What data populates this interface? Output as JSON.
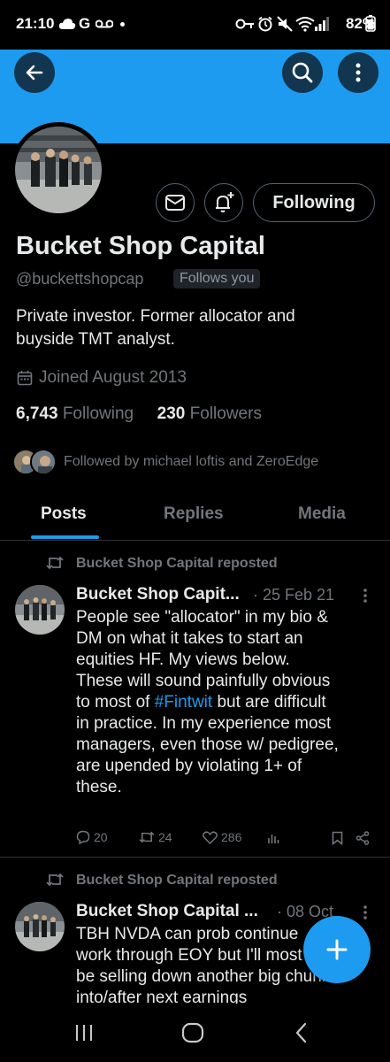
{
  "status_bar": {
    "time": "21:10",
    "carrier_letter": "G",
    "battery": "82%"
  },
  "profile": {
    "display_name": "Bucket Shop Capital",
    "handle": "@buckettshopcap",
    "follows_you_badge": "Follows you",
    "bio_line1": "Private investor. Former allocator and",
    "bio_line2": "buyside TMT analyst.",
    "joined": "Joined August 2013",
    "following_count": "6,743",
    "following_label": "Following",
    "followers_count": "230",
    "followers_label": "Followers",
    "followed_by": "Followed by michael loftis and ZeroEdge",
    "following_button": "Following"
  },
  "tabs": [
    {
      "label": "Posts",
      "active": true
    },
    {
      "label": "Replies",
      "active": false
    },
    {
      "label": "Media",
      "active": false
    }
  ],
  "tweets": [
    {
      "repost_label": "Bucket Shop Capital reposted",
      "author": "Bucket Shop Capit...",
      "date": "· 25 Feb 21",
      "text_lines": [
        "People see \"allocator\" in my bio &",
        "DM on what it takes to start an",
        "equities HF.  My views below.",
        "These will sound painfully obvious",
        "to most of ",
        " but are difficult",
        "in practice.  In my experience most",
        "managers, even those w/ pedigree,",
        "are upended by violating 1+ of",
        "these."
      ],
      "hashtag": "#Fintwit",
      "replies": "20",
      "reposts": "24",
      "likes": "286"
    },
    {
      "repost_label": "Bucket Shop Capital reposted",
      "author": "Bucket Shop Capital ...",
      "date": "· 08 Oct",
      "text_lines": [
        "TBH NVDA can prob continue",
        "work through EOY but I'll most likely",
        "be selling down another big chunk",
        "into/after next earnings"
      ]
    }
  ],
  "colors": {
    "accent": "#1d9bf0",
    "background": "#000000",
    "muted": "#71767b",
    "text": "#e7e9ea"
  },
  "icons": [
    "back-arrow-icon",
    "search-icon",
    "more-vertical-icon",
    "message-icon",
    "notification-bell-icon",
    "calendar-icon",
    "repost-icon",
    "reply-icon",
    "like-icon",
    "views-icon",
    "bookmark-icon",
    "share-icon",
    "plus-icon"
  ]
}
